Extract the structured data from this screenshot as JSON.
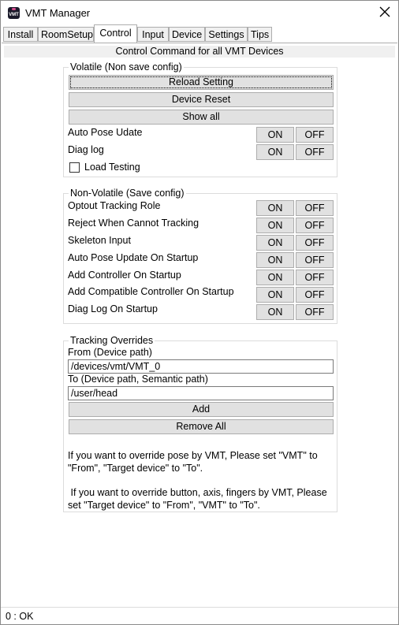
{
  "window": {
    "title": "VMT Manager",
    "icon_text": "VMT"
  },
  "tabs": [
    {
      "label": "Install"
    },
    {
      "label": "RoomSetup"
    },
    {
      "label": "Control"
    },
    {
      "label": "Input"
    },
    {
      "label": "Device"
    },
    {
      "label": "Settings"
    },
    {
      "label": "Tips"
    }
  ],
  "active_tab": "Control",
  "control": {
    "header": "Control Command for all VMT Devices",
    "volatile": {
      "title": "Volatile (Non save config)",
      "reload_label": "Reload Setting",
      "reset_label": "Device Reset",
      "show_all_label": "Show all",
      "rows": [
        {
          "label": "Auto Pose Udate",
          "on": "ON",
          "off": "OFF"
        },
        {
          "label": "Diag log",
          "on": "ON",
          "off": "OFF"
        }
      ],
      "load_testing_label": "Load Testing",
      "load_testing_checked": false
    },
    "nonvolatile": {
      "title": "Non-Volatile (Save config)",
      "rows": [
        {
          "label": "Optout Tracking Role",
          "on": "ON",
          "off": "OFF"
        },
        {
          "label": "Reject When Cannot Tracking",
          "on": "ON",
          "off": "OFF"
        },
        {
          "label": "Skeleton Input",
          "on": "ON",
          "off": "OFF"
        },
        {
          "label": "Auto Pose Update On Startup",
          "on": "ON",
          "off": "OFF"
        },
        {
          "label": "Add Controller On Startup",
          "on": "ON",
          "off": "OFF"
        },
        {
          "label": "Add Compatible Controller On Startup",
          "on": "ON",
          "off": "OFF"
        },
        {
          "label": "Diag Log On Startup",
          "on": "ON",
          "off": "OFF"
        }
      ]
    },
    "overrides": {
      "title": "Tracking Overrides",
      "from_label": "From (Device path)",
      "from_value": "/devices/vmt/VMT_0",
      "to_label": "To (Device path, Semantic path)",
      "to_value": "/user/head",
      "add_label": "Add",
      "remove_label": "Remove All",
      "info1": "If you want to override pose by VMT, Please set \"VMT\" to \"From\", \"Target device\" to \"To\".",
      "info2": " If you want to override button, axis, fingers by VMT, Please set \"Target device\" to \"From\", \"VMT\" to \"To\"."
    }
  },
  "status": {
    "text": "0 : OK"
  }
}
